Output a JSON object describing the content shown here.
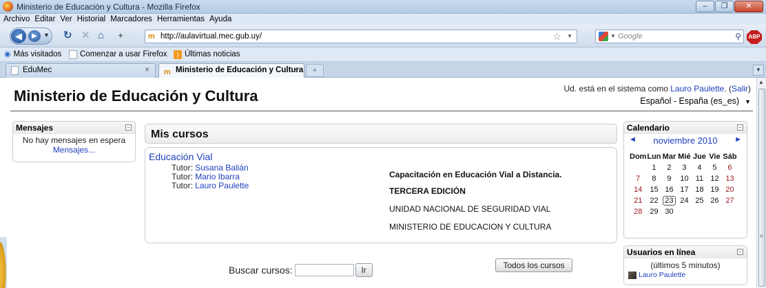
{
  "window": {
    "title": "Ministerio de Educación y Cultura - Mozilla Firefox",
    "buttons": [
      "–",
      "❐",
      "✕"
    ]
  },
  "menu": [
    "Archivo",
    "Editar",
    "Ver",
    "Historial",
    "Marcadores",
    "Herramientas",
    "Ayuda"
  ],
  "nav": {
    "url": "http://aulavirtual.mec.gub.uy/",
    "favicon_text": "m",
    "search_placeholder": "Google",
    "abp_label": "ABP"
  },
  "bookmarks": [
    "Más visitados",
    "Comenzar a usar Firefox",
    "Últimas noticias"
  ],
  "tabs": [
    {
      "label": "EduMec",
      "active": false
    },
    {
      "label": "Ministerio de Educación y Cultura",
      "active": true
    }
  ],
  "page": {
    "site_title": "Ministerio de Educación y Cultura",
    "login_prefix": "Ud. está en el sistema como ",
    "login_user": "Lauro Paulette",
    "login_logout": "Salir",
    "language": "Español - España (es_es)"
  },
  "messages": {
    "title": "Mensajes",
    "empty_text": "No hay mensajes en espera",
    "link": "Mensajes..."
  },
  "courses": {
    "title": "Mis cursos",
    "course_name": "Educación Vial",
    "tutor_label": "Tutor:",
    "tutors": [
      "Susana Balián",
      "Mario Ibarra",
      "Lauro Paulette"
    ],
    "summary": [
      "Capacitación en Educación Vial a Distancia.",
      "TERCERA EDICIÓN",
      "UNIDAD NACIONAL DE SEGURIDAD VIAL",
      "MINISTERIO DE EDUCACION Y CULTURA"
    ],
    "search_label": "Buscar cursos:",
    "search_value": "",
    "search_button": "Ir",
    "all_courses_button": "Todos los cursos"
  },
  "calendar": {
    "title": "Calendario",
    "month": "noviembre 2010",
    "prev": "◄",
    "next": "►",
    "weekdays": [
      "Dom",
      "Lun",
      "Mar",
      "Mié",
      "Jue",
      "Vie",
      "Sáb"
    ],
    "weeks": [
      [
        "",
        "1",
        "2",
        "3",
        "4",
        "5",
        "6"
      ],
      [
        "7",
        "8",
        "9",
        "10",
        "11",
        "12",
        "13"
      ],
      [
        "14",
        "15",
        "16",
        "17",
        "18",
        "19",
        "20"
      ],
      [
        "21",
        "22",
        "23",
        "24",
        "25",
        "26",
        "27"
      ],
      [
        "28",
        "29",
        "30",
        "",
        "",
        "",
        ""
      ]
    ],
    "today": "23",
    "weekend_color": "#a0171f"
  },
  "online": {
    "title": "Usuarios en línea",
    "subtitle": "(últimos 5 minutos)",
    "users": [
      "Lauro Paulette"
    ]
  },
  "colors": {
    "link": "#1e3fbe",
    "accent_chrome": "#c9dcef"
  }
}
